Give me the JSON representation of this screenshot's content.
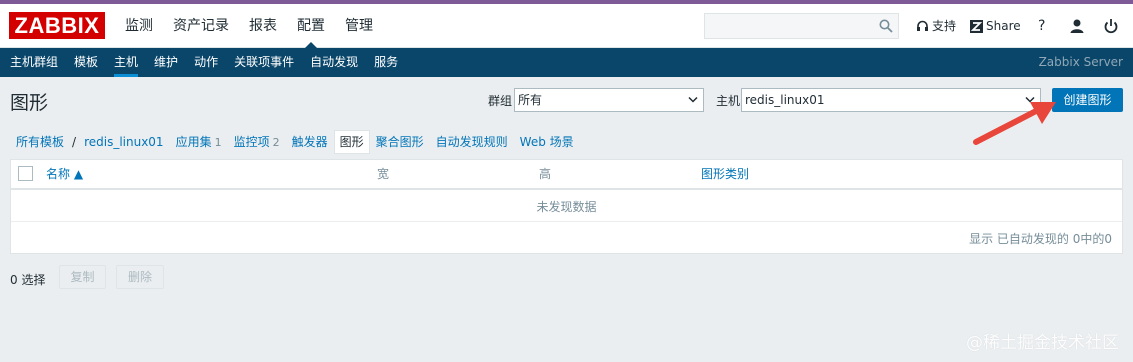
{
  "header": {
    "logo": "ZABBIX",
    "menu": [
      "监测",
      "资产记录",
      "报表",
      "配置",
      "管理"
    ],
    "active_menu": "配置",
    "support": "支持",
    "share": "Share",
    "help": "?",
    "search": {
      "value": "",
      "placeholder": ""
    }
  },
  "subnav": {
    "items": [
      "主机群组",
      "模板",
      "主机",
      "维护",
      "动作",
      "关联项事件",
      "自动发现",
      "服务"
    ],
    "active": "主机",
    "server": "Zabbix Server"
  },
  "page": {
    "title": "图形",
    "group_label": "群组",
    "group_value": "所有",
    "host_label": "主机",
    "host_value": "redis_linux01",
    "create_button": "创建图形"
  },
  "tabs": {
    "all_templates": "所有模板",
    "separator": "/",
    "host": "redis_linux01",
    "applications": "应用集",
    "applications_count": "1",
    "items": "监控项",
    "items_count": "2",
    "triggers": "触发器",
    "graphs": "图形",
    "screens": "聚合图形",
    "discovery": "自动发现规则",
    "web": "Web 场景"
  },
  "table": {
    "columns": [
      "名称 ▲",
      "宽",
      "高",
      "图形类别"
    ],
    "empty": "未发现数据",
    "paging": "显示 已自动发现的 0中的0"
  },
  "footer": {
    "selected": "0 选择",
    "copy": "复制",
    "delete": "删除"
  },
  "watermark": "@稀土掘金技术社区",
  "colors": {
    "brand": "#d40000",
    "nav": "#0a466a",
    "primary": "#0275b8",
    "arrow": "#e8463a"
  }
}
